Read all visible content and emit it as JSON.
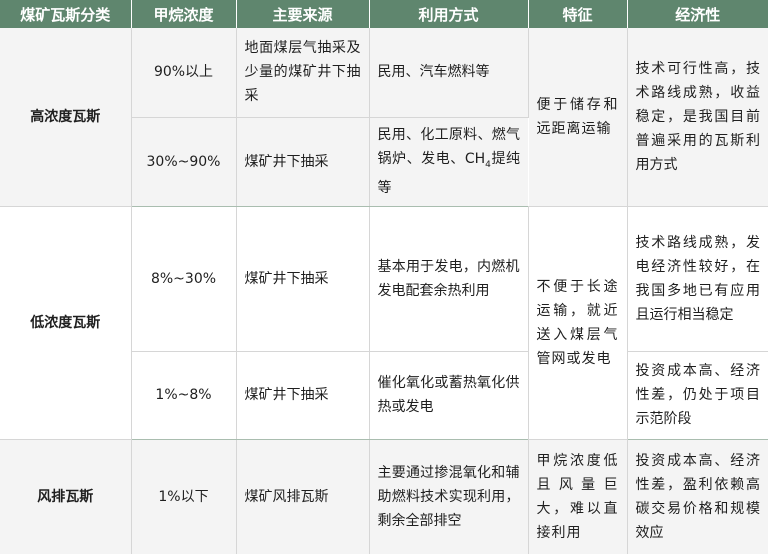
{
  "headers": [
    "煤矿瓦斯分类",
    "甲烷浓度",
    "主要来源",
    "利用方式",
    "特征",
    "经济性"
  ],
  "groups": {
    "high": {
      "category": "高浓度瓦斯",
      "feature": "便于储存和远距离运输",
      "economy": "技术可行性高，技术路线成熟，收益稳定，是我国目前普遍采用的瓦斯利用方式",
      "rows": [
        {
          "concentration": "90%以上",
          "source": "地面煤层气抽采及少量的煤矿井下抽采",
          "usage": "民用、汽车燃料等"
        },
        {
          "concentration": "30%~90%",
          "source": "煤矿井下抽采",
          "usage_main": "民用、化工原料、燃气锅炉、发电、",
          "usage_ch": "CH",
          "usage_sub": "4",
          "usage_tail": "提纯等"
        }
      ]
    },
    "low": {
      "category": "低浓度瓦斯",
      "feature": "不便于长途运输，就近送入煤层气管网或发电",
      "rows": [
        {
          "concentration": "8%~30%",
          "source": "煤矿井下抽采",
          "usage": "基本用于发电，内燃机发电配套余热利用",
          "economy": "技术路线成熟，发电经济性较好，在我国多地已有应用且运行相当稳定"
        },
        {
          "concentration": "1%~8%",
          "source": "煤矿井下抽采",
          "usage": "催化氧化或蓄热氧化供热或发电",
          "economy": "投资成本高、经济性差，仍处于项目示范阶段"
        }
      ]
    },
    "wind": {
      "category": "风排瓦斯",
      "concentration": "1%以下",
      "source": "煤矿风排瓦斯",
      "usage": "主要通过掺混氧化和辅助燃料技术实现利用，剩余全部排空",
      "feature": "甲烷浓度低且风量巨大，难以直接利用",
      "economy": "投资成本高、经济性差，盈利依赖高碳交易价格和规模效应"
    }
  },
  "colors": {
    "header_bg": "#5f866e",
    "header_text": "#ffffff",
    "band_gray": "#f4f4f4",
    "band_white": "#ffffff",
    "grid": "#d6d6d6"
  }
}
